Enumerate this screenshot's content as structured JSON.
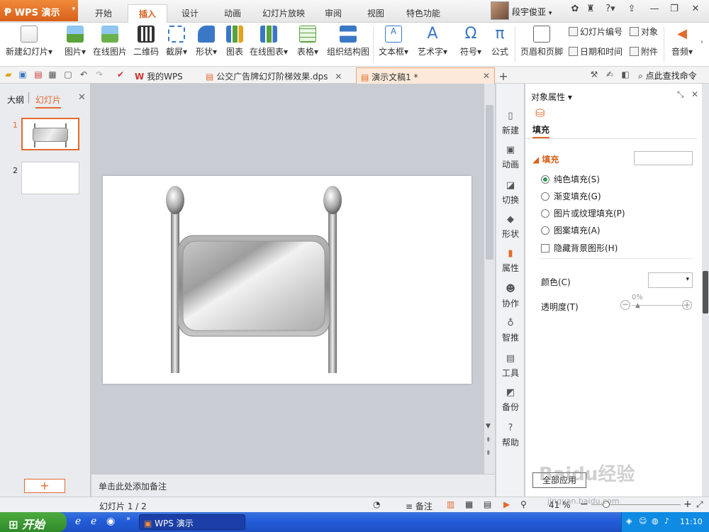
{
  "app": {
    "name": "WPS 演示"
  },
  "menu_tabs": [
    "开始",
    "插入",
    "设计",
    "动画",
    "幻灯片放映",
    "审阅",
    "视图",
    "特色功能"
  ],
  "active_tab": "插入",
  "user": {
    "name": "段宇俊亚"
  },
  "ribbon": {
    "new_slide": "新建幻灯片",
    "picture": "图片",
    "online_picture": "在线图片",
    "qrcode": "二维码",
    "screenshot": "截屏",
    "shape": "形状",
    "chart": "图表",
    "online_chart": "在线图表",
    "table": "表格",
    "org_chart": "组织结构图",
    "textbox": "文本框",
    "wordart": "艺术字",
    "symbol": "符号",
    "formula": "公式",
    "header_footer": "页眉和页脚",
    "slide_number": "幻灯片编号",
    "object": "对象",
    "datetime": "日期和时间",
    "attachment": "附件",
    "audio": "音频"
  },
  "doc_tabs": {
    "my_wps": "我的WPS",
    "file1": "公交广告牌幻灯阶梯效果.dps",
    "file2": "演示文稿1 *",
    "search": "点此查找命令"
  },
  "left_panel": {
    "outline_tab": "大纲",
    "slides_tab": "幻灯片",
    "slide_numbers": [
      "1",
      "2"
    ]
  },
  "notes_placeholder": "单击此处添加备注",
  "side_toolbar": [
    "新建",
    "动画",
    "切换",
    "形状",
    "属性",
    "协作",
    "智推",
    "工具",
    "备份",
    "帮助"
  ],
  "properties": {
    "title": "对象属性",
    "fill_tab": "填充",
    "fill_section": "填充",
    "options": [
      "纯色填充(S)",
      "渐变填充(G)",
      "图片或纹理填充(P)",
      "图案填充(A)"
    ],
    "selected_option": 0,
    "hide_bg_graphics": "隐藏背景图形(H)",
    "color_label": "颜色(C)",
    "transparency_label": "透明度(T)",
    "transparency_value": "0%",
    "apply_all_button": "全部应用"
  },
  "status": {
    "slide_info": "幻灯片 1 / 2",
    "notes": "备注",
    "zoom": "41 %"
  },
  "taskbar": {
    "start": "开始",
    "task": "WPS 演示",
    "time": "11:10"
  },
  "watermark": "Baidu经验 jingyan.baidu.com"
}
